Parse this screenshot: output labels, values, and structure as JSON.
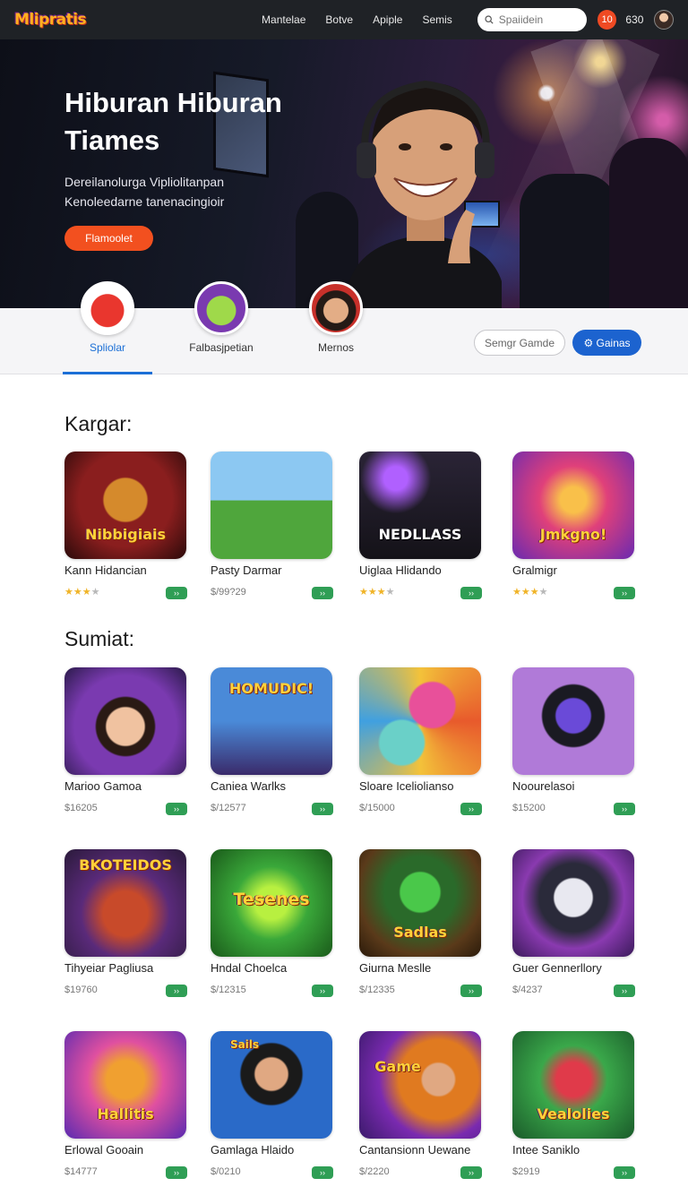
{
  "topbar": {
    "logo": "Mlipratis",
    "nav": [
      "Mantelae",
      "Botve",
      "Apiple",
      "Semis"
    ],
    "search_placeholder": "Spaiidein",
    "notification_count": "10",
    "coins": "630"
  },
  "hero": {
    "title": "Hiburan Hiburan Tiames",
    "subtitle": "Dereilanolurga Vipliolitanpan Kenoleedarne tanenacingioir",
    "button": "Flamoolet"
  },
  "categories": {
    "items": [
      {
        "label": "Spliolar"
      },
      {
        "label": "Falbasjpetian"
      },
      {
        "label": "Mernos"
      }
    ],
    "button_outline": "Semgr Gamde",
    "button_primary": "Gainas",
    "button_primary_icon": "gamepad-icon"
  },
  "sections": [
    {
      "title": "Kargar:",
      "cards": [
        {
          "title": "Kann Hidancian",
          "rating": 3,
          "badge": "›› ",
          "art_text": "Nibbigiais"
        },
        {
          "title": "Pasty Darmar",
          "meta": "$/99?29",
          "badge": "››",
          "art_text": ""
        },
        {
          "title": "Uiglaa Hlidando",
          "rating": 3,
          "badge": "››",
          "art_text": "NEDLLASS"
        },
        {
          "title": "Gralmigr",
          "rating": 3,
          "badge": "››",
          "art_text": "Jmkgno!"
        }
      ]
    },
    {
      "title": "Sumiat:",
      "cards": [
        {
          "title": "Marioo Gamoa",
          "meta": "$16205",
          "badge": "››",
          "art_text": ""
        },
        {
          "title": "Caniea Warlks",
          "meta": "$/12577",
          "badge": "››",
          "art_text": "HOMUDIC!"
        },
        {
          "title": "Sloare Iceliolianso",
          "meta": "$/15000",
          "badge": "››",
          "art_text": ""
        },
        {
          "title": "Noourelasoi",
          "meta": "$15200",
          "badge": "››",
          "art_text": ""
        },
        {
          "title": "Tihyeiar Pagliusa",
          "meta": "$19760",
          "badge": "››",
          "art_text": "BKOTEIDOS"
        },
        {
          "title": "Hndal Choelca",
          "meta": "$/12315",
          "badge": "››",
          "art_text": "Tesenes"
        },
        {
          "title": "Giurna Meslle",
          "meta": "$/12335",
          "badge": "››",
          "art_text": "Sadlas"
        },
        {
          "title": "Guer Gennerllory",
          "meta": "$/4237",
          "badge": "››",
          "art_text": ""
        },
        {
          "title": "Erlowal Gooain",
          "meta": "$14777",
          "badge": "››",
          "art_text": "Hallitis"
        },
        {
          "title": "Gamlaga Hlaido",
          "meta": "$/0210",
          "badge": "››",
          "art_text": "Sails"
        },
        {
          "title": "Cantansionn Uewane",
          "meta": "$/2220",
          "badge": "››",
          "art_text": "Game"
        },
        {
          "title": "Intee Saniklo",
          "meta": "$2919",
          "badge": "››",
          "art_text": "Vealolies"
        }
      ]
    }
  ],
  "colors": {
    "accent": "#f2501f",
    "primary": "#1c63cf",
    "badge": "#2f9e55"
  }
}
